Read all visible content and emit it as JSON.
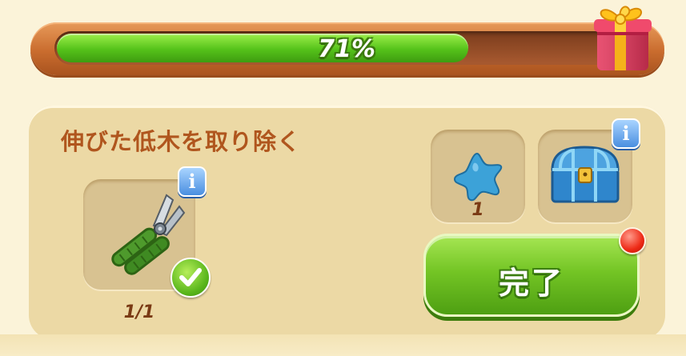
{
  "progress": {
    "label": "71%",
    "value": 0.71,
    "fill_color": "#55c21a"
  },
  "reward_icon": "gift-box-icon",
  "task": {
    "title": "伸びた低木を取り除く",
    "requirement": {
      "icon": "pruning-shears-icon",
      "count_label": "1/1",
      "completed": true
    },
    "rewards": [
      {
        "icon": "blue-star-icon",
        "count_label": "1"
      },
      {
        "icon": "treasure-chest-icon"
      }
    ],
    "complete_button": {
      "label": "完了",
      "color": "#74c525"
    },
    "info_badge_text": "i"
  },
  "colors": {
    "background": "#fbf3d9",
    "panel": "#ecd9a5",
    "title": "#b0561e",
    "notification": "#ee2a16"
  }
}
